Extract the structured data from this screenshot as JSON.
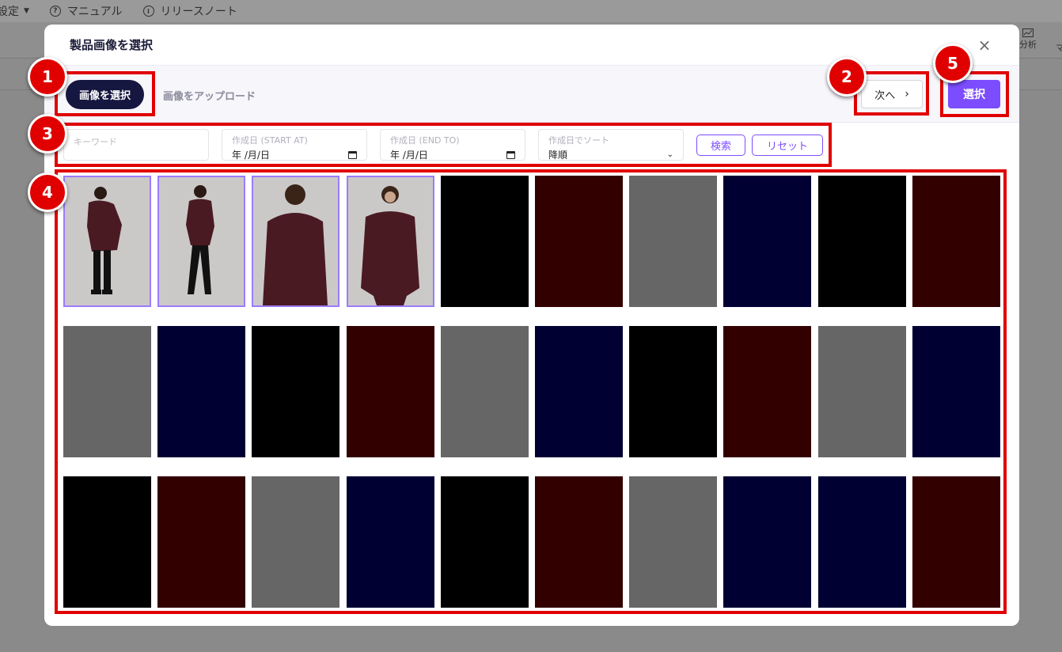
{
  "background": {
    "topbar": {
      "settings_label": "設定",
      "manual_label": "マニュアル",
      "release_notes_label": "リリースノート"
    },
    "analysis_label": "分析",
    "ma_label": "マ"
  },
  "modal": {
    "title": "製品画像を選択",
    "tabs": {
      "select_images": "画像を選択",
      "upload_images": "画像をアップロード"
    },
    "next_label": "次へ",
    "select_label": "選択",
    "filters": {
      "keyword_placeholder": "キーワード",
      "start_label": "作成日 (START AT)",
      "start_value": "年 /月/日",
      "end_label": "作成日 (END TO)",
      "end_value": "年 /月/日",
      "sort_label": "作成日でソート",
      "sort_value": "降順",
      "search_label": "検索",
      "reset_label": "リセット"
    },
    "images": [
      {
        "kind": "photo",
        "pose": "back",
        "selected": true
      },
      {
        "kind": "photo",
        "pose": "standing",
        "selected": true
      },
      {
        "kind": "photo",
        "pose": "back-close",
        "selected": true
      },
      {
        "kind": "photo",
        "pose": "front",
        "selected": true
      },
      {
        "kind": "swatch",
        "color": "#000000"
      },
      {
        "kind": "swatch",
        "color": "#330000"
      },
      {
        "kind": "swatch",
        "color": "#666666"
      },
      {
        "kind": "swatch",
        "color": "#000033"
      },
      {
        "kind": "swatch",
        "color": "#000000"
      },
      {
        "kind": "swatch",
        "color": "#330000"
      },
      {
        "kind": "swatch",
        "color": "#666666"
      },
      {
        "kind": "swatch",
        "color": "#000033"
      },
      {
        "kind": "swatch",
        "color": "#000000"
      },
      {
        "kind": "swatch",
        "color": "#330000"
      },
      {
        "kind": "swatch",
        "color": "#666666"
      },
      {
        "kind": "swatch",
        "color": "#000033"
      },
      {
        "kind": "swatch",
        "color": "#000000"
      },
      {
        "kind": "swatch",
        "color": "#330000"
      },
      {
        "kind": "swatch",
        "color": "#666666"
      },
      {
        "kind": "swatch",
        "color": "#000033"
      },
      {
        "kind": "swatch",
        "color": "#000000"
      },
      {
        "kind": "swatch",
        "color": "#330000"
      },
      {
        "kind": "swatch",
        "color": "#666666"
      },
      {
        "kind": "swatch",
        "color": "#000033"
      },
      {
        "kind": "swatch",
        "color": "#000000"
      },
      {
        "kind": "swatch",
        "color": "#330000"
      },
      {
        "kind": "swatch",
        "color": "#666666"
      },
      {
        "kind": "swatch",
        "color": "#000033"
      },
      {
        "kind": "swatch",
        "color": "#000033"
      },
      {
        "kind": "swatch",
        "color": "#330000"
      }
    ]
  },
  "annotations": {
    "badge_1": "1",
    "badge_2": "2",
    "badge_3": "3",
    "badge_4": "4",
    "badge_5": "5",
    "color": "#e00000"
  },
  "colors": {
    "accent": "#7c4dff",
    "dark_tab": "#151740"
  }
}
